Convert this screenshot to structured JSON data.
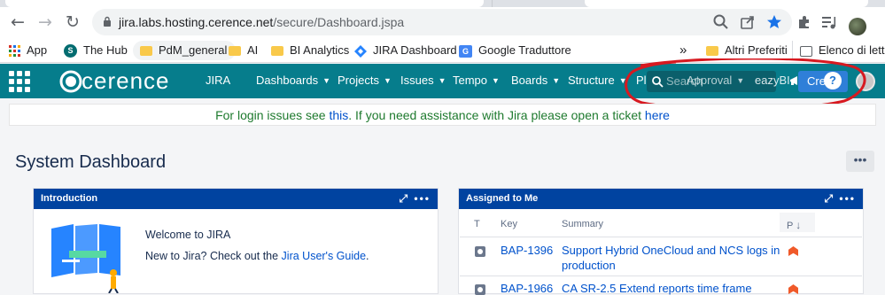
{
  "browser": {
    "url_host": "jira.labs.hosting.cerence.net",
    "url_path": "/secure/Dashboard.jspa",
    "back_icon": "←",
    "forward_icon": "→",
    "reload_icon": "↻"
  },
  "bookmarks": {
    "items": [
      {
        "label": "App"
      },
      {
        "label": "The Hub"
      },
      {
        "label": "PdM_general"
      },
      {
        "label": "AI"
      },
      {
        "label": "BI Analytics"
      },
      {
        "label": "JIRA Dashboard"
      },
      {
        "label": "Google Traduttore"
      }
    ],
    "overflow": "»",
    "others": "Altri Preferiti",
    "reading_list": "Elenco di lettur"
  },
  "jira": {
    "product": "JIRA",
    "brand": "cerence",
    "nav": [
      {
        "label": "Dashboards"
      },
      {
        "label": "Projects"
      },
      {
        "label": "Issues"
      },
      {
        "label": "Tempo"
      },
      {
        "label": "Boards"
      },
      {
        "label": "Structure"
      },
      {
        "label": "Plans"
      },
      {
        "label": "Approval"
      },
      {
        "label": "eazyBI"
      }
    ],
    "search_placeholder": "Search",
    "create_label": "Create",
    "help": "?"
  },
  "banner": {
    "part1": "For login issues see ",
    "link1": "this",
    "part2": ". If you need assistance with Jira please open a ticket ",
    "link2": "here"
  },
  "page": {
    "title": "System Dashboard",
    "more": "•••"
  },
  "intro_gadget": {
    "title": "Introduction",
    "welcome": "Welcome to JIRA",
    "guide_prefix": "New to Jira? Check out the ",
    "guide_link": "Jira User's Guide",
    "guide_suffix": "."
  },
  "assigned_gadget": {
    "title": "Assigned to Me",
    "columns": [
      "T",
      "Key",
      "Summary",
      "P"
    ],
    "rows": [
      {
        "key": "BAP-1396",
        "summary_line1": "Support Hybrid OneCloud and NCS logs in",
        "summary_line2": "production"
      },
      {
        "key": "BAP-1966",
        "summary_line1": "CA SR-2.5 Extend reports time frame"
      }
    ]
  },
  "colors": {
    "jira_header": "#067d8c",
    "gadget_header": "#0043a0",
    "banner_text": "#1e7a2e",
    "annotation": "#d71920"
  }
}
